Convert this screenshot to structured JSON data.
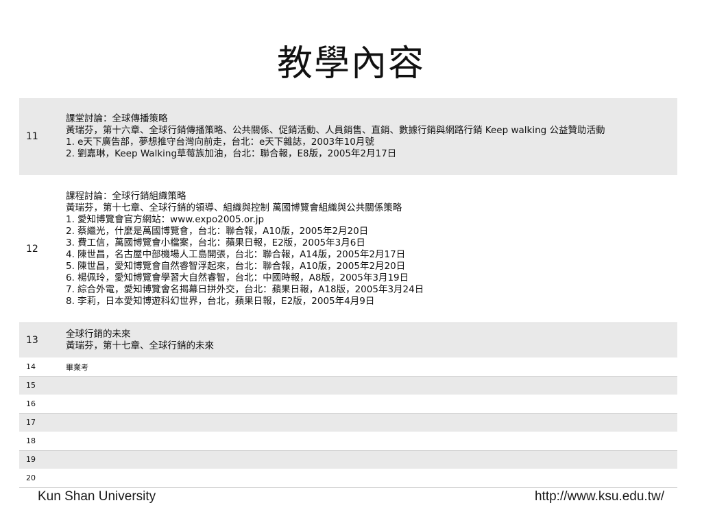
{
  "title": "教學內容",
  "rows": [
    {
      "num": "11",
      "lines": [
        "課堂討論：全球傳播策略",
        "黃瑞芬，第十六章、全球行銷傳播策略、公共關係、促銷活動、人員銷售、直銷、數據行銷與網路行銷 Keep walking 公益贊助活動",
        "1. e天下廣告部，夢想推守台灣向前走，台北：e天下雜誌，2003年10月號",
        "2. 劉嘉琳，Keep Walking草莓族加油，台北：聯合報，E8版，2005年2月17日"
      ]
    },
    {
      "num": "12",
      "lines": [
        "課程討論：全球行銷組織策略",
        "黃瑞芬，第十七章、全球行銷的領導、組織與控制 萬國博覽會組織與公共關係策略",
        "1. 愛知博覽會官方網站：www.expo2005.or.jp",
        "2. 蔡繼光，什麼是萬國博覽會，台北：聯合報，A10版，2005年2月20日",
        "3. 費工信，萬國博覽會小檔案，台北：蘋果日報，E2版，2005年3月6日",
        "4. 陳世昌，名古屋中部機場人工島開張，台北：聯合報，A14版，2005年2月17日",
        "5. 陳世昌，愛知博覽會自然睿智浮起來，台北：聯合報，A10版，2005年2月20日",
        "6. 楊佩玲，愛知博覽會學習大自然睿智，台北：中國時報，A8版，2005年3月19日",
        "7. 綜合外電，愛知博覽會名揭幕日拼外交，台北：蘋果日報，A18版，2005年3月24日",
        "8. 李莉，日本愛知博遊科幻世界，台北，蘋果日報，E2版，2005年4月9日"
      ]
    },
    {
      "num": "13",
      "lines": [
        "全球行銷的未來",
        "黃瑞芬，第十七章、全球行銷的未來"
      ]
    }
  ],
  "small_rows": [
    {
      "num": "14",
      "text": "畢業考"
    },
    {
      "num": "15",
      "text": ""
    },
    {
      "num": "16",
      "text": ""
    },
    {
      "num": "17",
      "text": ""
    },
    {
      "num": "18",
      "text": ""
    },
    {
      "num": "19",
      "text": ""
    },
    {
      "num": "20",
      "text": ""
    }
  ],
  "footer": {
    "left": "Kun Shan University",
    "right": "http://www.ksu.edu.tw/"
  }
}
